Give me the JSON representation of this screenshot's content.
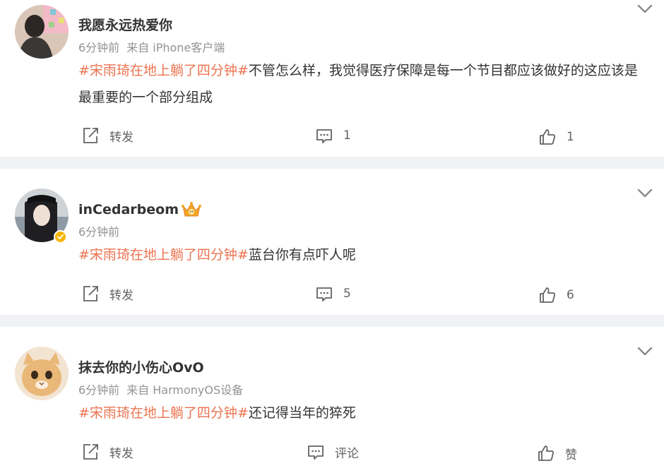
{
  "comments": [
    {
      "username": "我愿永远热爱你",
      "time": "6分钟前",
      "source": "来自 iPhone客户端",
      "topic": "#宋雨琦在地上躺了四分钟#",
      "text": "不管怎么样，我觉得医疗保障是每一个节目都应该做好的这应该是最重要的一个部分组成",
      "repost_label": "转发",
      "comment_count": "1",
      "like_count": "1"
    },
    {
      "username": "inCedarbeom",
      "time": "6分钟前",
      "source": "",
      "topic": "#宋雨琦在地上躺了四分钟#",
      "text": "蓝台你有点吓人呢",
      "repost_label": "转发",
      "comment_count": "5",
      "like_count": "6"
    },
    {
      "username": "抹去你的小伤心OvO",
      "time": "6分钟前",
      "source": "来自 HarmonyOS设备",
      "topic": "#宋雨琦在地上躺了四分钟#",
      "text": "还记得当年的猝死",
      "repost_label": "转发",
      "comment_count": "评论",
      "like_count": "赞"
    }
  ],
  "colors": {
    "topic": "#eb7350",
    "username": "#333333",
    "meta": "#939393",
    "action": "#636363",
    "separator": "#f1f2f5",
    "verified_badge": "#f7b500"
  },
  "icons": {
    "more": "chevron-down-icon",
    "repost": "repost-icon",
    "comment": "comment-icon",
    "like": "thumbs-up-icon",
    "verified": "verified-badge-icon",
    "member": "crown-icon"
  }
}
